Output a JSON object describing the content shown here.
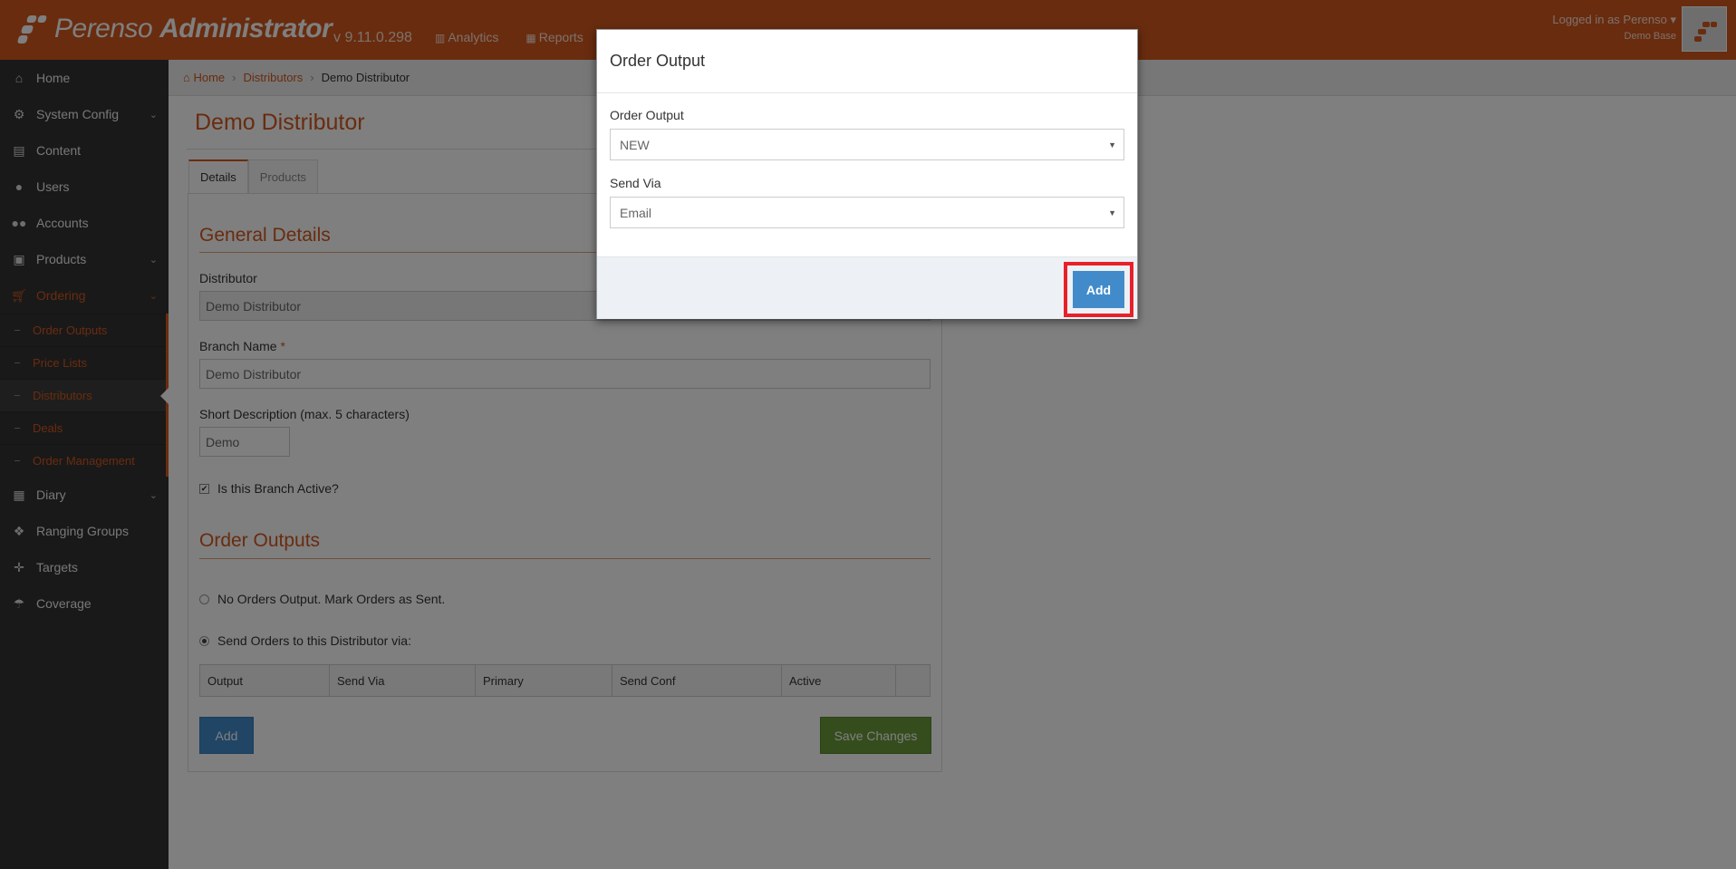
{
  "header": {
    "app_name": "Perenso",
    "app_suffix": "Administrator",
    "version": "v 9.11.0.298",
    "nav": [
      {
        "label": "Analytics",
        "icon": "bar-chart-icon"
      },
      {
        "label": "Reports",
        "icon": "table-icon"
      }
    ],
    "user_label": "Logged in as Perenso",
    "user_sub": "Demo Base"
  },
  "sidebar": {
    "items": [
      {
        "label": "Home",
        "icon": "home-icon"
      },
      {
        "label": "System Config",
        "icon": "gear-icon"
      },
      {
        "label": "Content",
        "icon": "file-icon"
      },
      {
        "label": "Users",
        "icon": "user-icon"
      },
      {
        "label": "Accounts",
        "icon": "users-icon"
      },
      {
        "label": "Products",
        "icon": "gift-icon"
      },
      {
        "label": "Ordering",
        "icon": "cart-icon"
      },
      {
        "label": "Diary",
        "icon": "calendar-icon"
      },
      {
        "label": "Ranging Groups",
        "icon": "cubes-icon"
      },
      {
        "label": "Targets",
        "icon": "crosshairs-icon"
      },
      {
        "label": "Coverage",
        "icon": "umbrella-icon"
      }
    ],
    "ordering_sub": [
      "Order Outputs",
      "Price Lists",
      "Distributors",
      "Deals",
      "Order Management"
    ]
  },
  "breadcrumb": {
    "home": "Home",
    "distributors": "Distributors",
    "current": "Demo Distributor"
  },
  "page": {
    "title": "Demo Distributor",
    "tabs": [
      "Details",
      "Products"
    ],
    "general_title": "General Details",
    "distributor_label": "Distributor",
    "distributor_value": "Demo Distributor",
    "branch_label": "Branch Name",
    "branch_required": "*",
    "branch_value": "Demo Distributor",
    "short_label": "Short Description (max. 5 characters)",
    "short_value": "Demo",
    "active_label": "Is this Branch Active?",
    "outputs_title": "Order Outputs",
    "radio_none": "No Orders Output. Mark Orders as Sent.",
    "radio_send": "Send Orders to this Distributor via:",
    "table_headers": [
      "Output",
      "Send Via",
      "Primary",
      "Send Conf",
      "Active",
      ""
    ],
    "add_label": "Add",
    "save_label": "Save Changes"
  },
  "modal": {
    "title": "Order Output",
    "output_label": "Order Output",
    "output_value": "NEW",
    "sendvia_label": "Send Via",
    "sendvia_value": "Email",
    "add_label": "Add",
    "highlight_color": "#e8202a"
  },
  "colors": {
    "brand": "#d2581f",
    "primary": "#428bca",
    "success": "#6b9b3a"
  }
}
